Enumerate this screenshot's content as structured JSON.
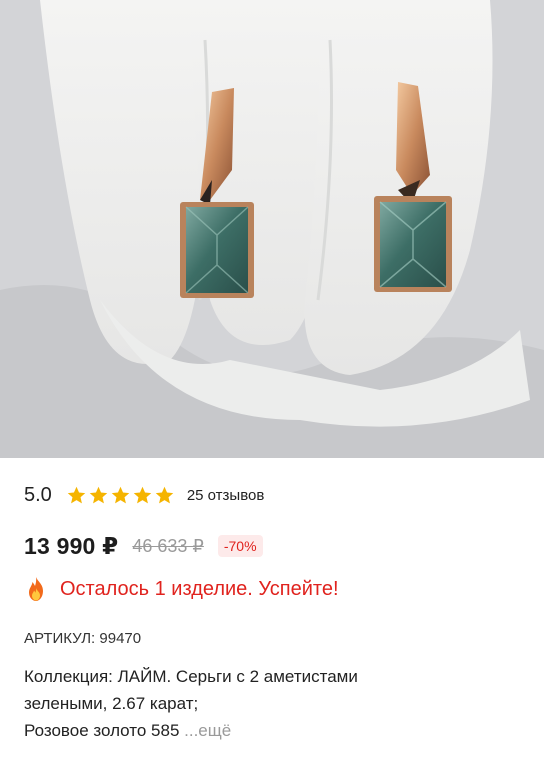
{
  "product": {
    "image_alt": "earrings-photo"
  },
  "rating": {
    "value": "5.0",
    "stars": 5,
    "reviews": "25 отзывов"
  },
  "price": {
    "current": "13 990 ₽",
    "old": "46 633 ₽",
    "discount": "-70%"
  },
  "stock": {
    "message": "Осталось 1 изделие. Успейте!"
  },
  "sku": {
    "text": "АРТИКУЛ: 99470"
  },
  "description": {
    "line1": "Коллекция: ЛАЙМ. Серьги с 2 аметистами",
    "line2": "зелеными, 2.67 карат;",
    "line3": "Розовое золото 585",
    "more_label": "...ещё"
  },
  "colors": {
    "accent_red": "#e0231e",
    "star": "#f5b400",
    "muted": "#9a9a9a"
  },
  "icons": [
    "star-icon",
    "fire-icon"
  ]
}
